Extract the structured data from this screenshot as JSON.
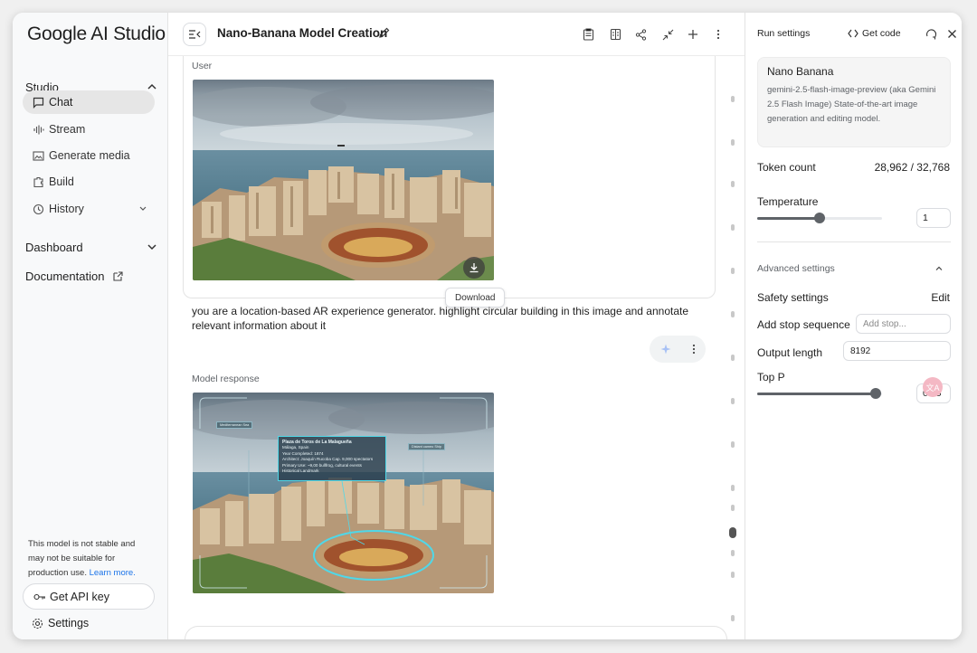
{
  "app": {
    "logo": "Google AI Studio"
  },
  "sidebar": {
    "studio_label": "Studio",
    "items": [
      {
        "label": "Chat",
        "icon": "chat-icon"
      },
      {
        "label": "Stream",
        "icon": "stream-icon"
      },
      {
        "label": "Generate media",
        "icon": "image-icon"
      },
      {
        "label": "Build",
        "icon": "build-icon"
      },
      {
        "label": "History",
        "icon": "history-icon"
      }
    ],
    "dashboard_label": "Dashboard",
    "documentation_label": "Documentation",
    "disclaimer": "This model is not stable and may not be suitable for production use.",
    "learn_more": "Learn more.",
    "api_key_label": "Get API key",
    "settings_label": "Settings"
  },
  "main": {
    "title": "Nano-Banana Model Creation",
    "user_label": "User",
    "download_tooltip": "Download",
    "prompt_text": "you are a location-based AR experience generator. highlight circular building in this image and annotate relevant information about it",
    "model_label": "Model response",
    "annotation": {
      "title": "Plaza de Toros de La Malagueña",
      "location": "Málaga, Spain",
      "year": "Year Completed: 1874",
      "architect": "Architect: Joaquín Rucoba",
      "capacity": "Cap. 9,000 spectators",
      "use": "Primary Use: ~9,00 bullfrog, cultural events",
      "landmark": "Historical Landmark",
      "tag_left": "Mediterranean Sea",
      "tag_right": "Distant cameo Ship"
    }
  },
  "panel": {
    "title": "Run settings",
    "get_code": "Get code",
    "model_name": "Nano Banana",
    "model_desc": "gemini-2.5-flash-image-preview (aka Gemini 2.5 Flash Image) State-of-the-art image generation and editing model.",
    "token_label": "Token count",
    "token_value": "28,962 / 32,768",
    "temperature_label": "Temperature",
    "temperature_value": "1",
    "temperature_level": 0.5,
    "advanced_label": "Advanced settings",
    "safety_label": "Safety settings",
    "safety_edit": "Edit",
    "stop_label": "Add stop sequence",
    "stop_placeholder": "Add stop...",
    "output_label": "Output length",
    "output_value": "8192",
    "topp_label": "Top P",
    "topp_value": "0.95",
    "topp_level": 0.95
  },
  "colors": {
    "accent_link": "#1a73e8",
    "ar_cyan": "#4fd8e8"
  }
}
